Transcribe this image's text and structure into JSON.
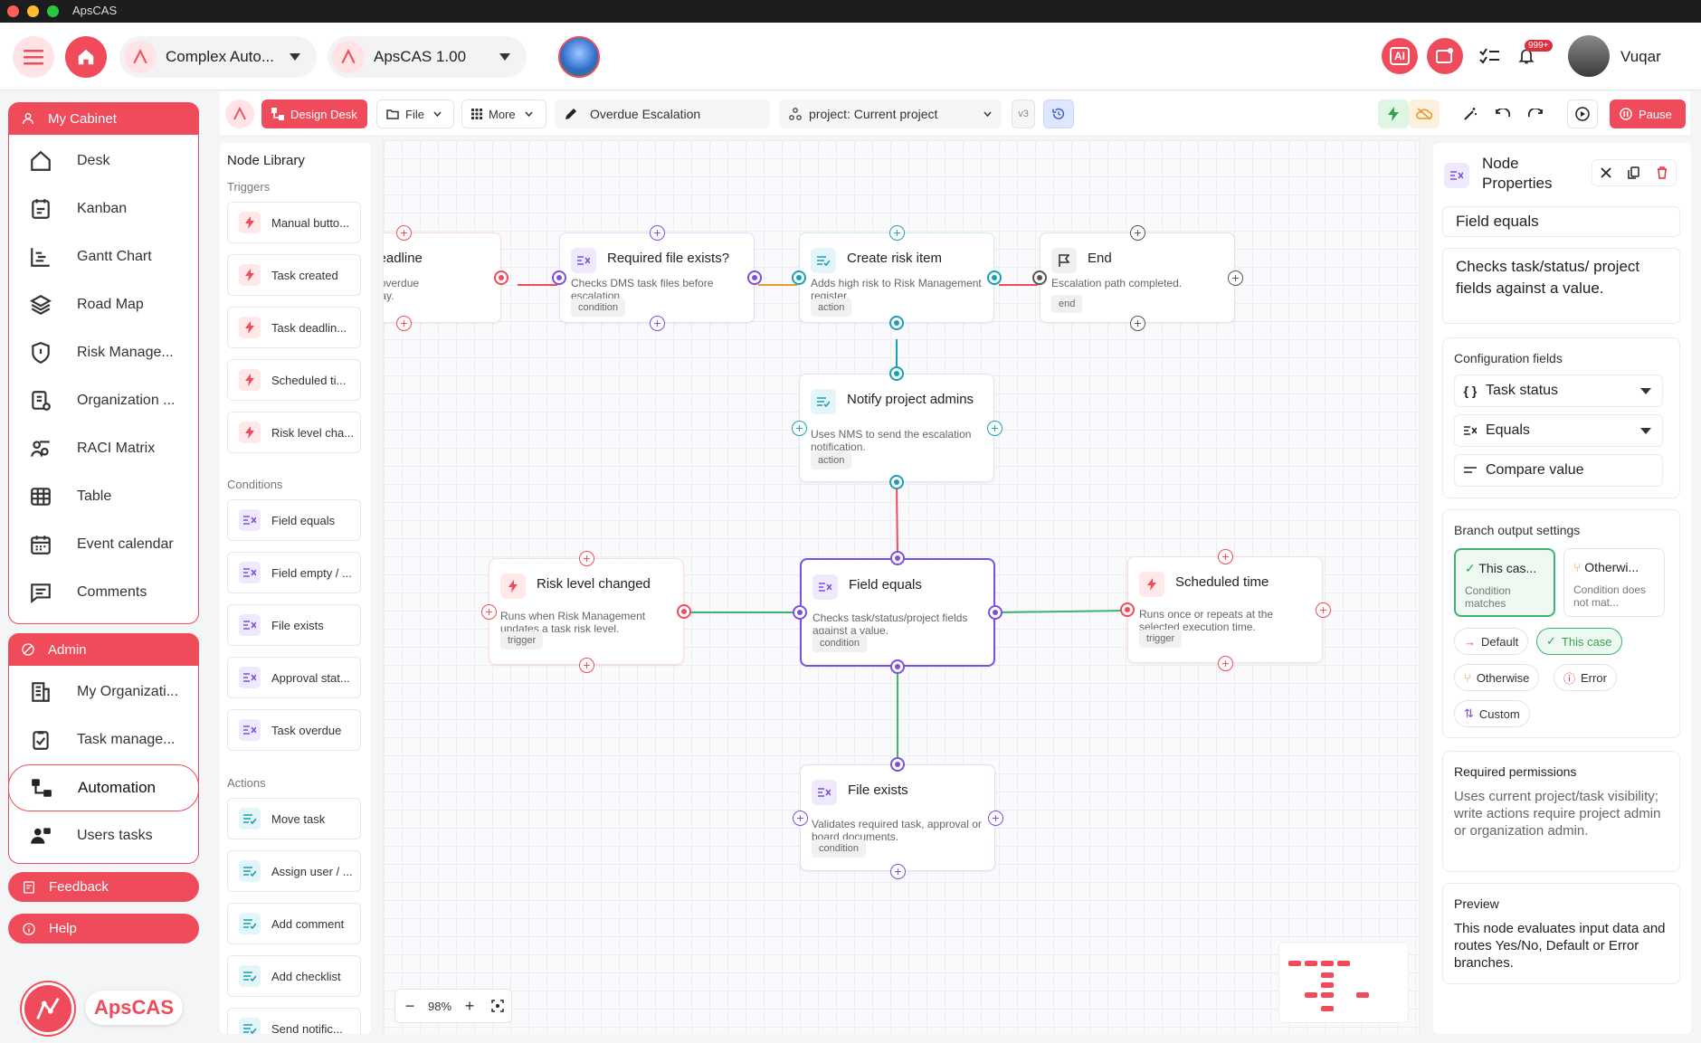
{
  "app": {
    "title": "ApsCAS",
    "user_name": "Vuqar",
    "notif_badge": "999+"
  },
  "header": {
    "project_selector": "Complex Auto...",
    "version_selector": "ApsCAS 1.00",
    "ai_label": "AI"
  },
  "sidebar": {
    "cabinet_title": "My Cabinet",
    "cabinet_items": [
      {
        "label": "Desk"
      },
      {
        "label": "Kanban"
      },
      {
        "label": "Gantt Chart"
      },
      {
        "label": "Road Map"
      },
      {
        "label": "Risk Manage..."
      },
      {
        "label": "Organization ..."
      },
      {
        "label": "RACI Matrix"
      },
      {
        "label": "Table"
      },
      {
        "label": "Event calendar"
      },
      {
        "label": "Comments"
      }
    ],
    "admin_title": "Admin",
    "admin_items": [
      {
        "label": "My Organizati..."
      },
      {
        "label": "Task manage..."
      },
      {
        "label": "Automation"
      },
      {
        "label": "Users tasks"
      }
    ],
    "feedback": "Feedback",
    "help": "Help",
    "logo_text": "ApsCAS"
  },
  "toolbar": {
    "design_desk": "Design Desk",
    "file": "File",
    "more": "More",
    "flow_name": "Overdue Escalation",
    "project": "project: Current project",
    "version": "v3",
    "pause": "Pause"
  },
  "library": {
    "title": "Node Library",
    "triggers_label": "Triggers",
    "triggers": [
      "Manual butto...",
      "Task created",
      "Task deadlin...",
      "Scheduled ti...",
      "Risk level cha..."
    ],
    "conditions_label": "Conditions",
    "conditions": [
      "Field equals",
      "Field empty / ...",
      "File exists",
      "Approval stat...",
      "Task overdue"
    ],
    "actions_label": "Actions",
    "actions": [
      "Move task",
      "Assign user / ...",
      "Add comment",
      "Add checklist",
      "Send notific..."
    ]
  },
  "canvas": {
    "zoom": "98%",
    "nodes": {
      "deadline": {
        "title": "sk deadline\nssed",
        "desc": "eduler emits overdue\nts once per day."
      },
      "required": {
        "title": "Required file exists?",
        "desc": "Checks DMS task files before escalation.",
        "tag": "condition"
      },
      "create": {
        "title": "Create risk item",
        "desc": "Adds high risk to Risk Management register.",
        "tag": "action"
      },
      "end": {
        "title": "End",
        "desc": "Escalation path completed.",
        "tag": "end"
      },
      "notify": {
        "title": "Notify project admins",
        "desc": "Uses NMS to send the escalation notification.",
        "tag": "action"
      },
      "risk": {
        "title": "Risk level changed",
        "desc": "Runs when Risk Management updates a task risk level.",
        "tag": "trigger"
      },
      "field": {
        "title": "Field equals",
        "desc": "Checks task/status/project fields against a value.",
        "tag": "condition"
      },
      "sched": {
        "title": "Scheduled time",
        "desc": "Runs once or repeats at the selected execution time.",
        "tag": "trigger"
      },
      "file": {
        "title": "File exists",
        "desc": "Validates required task, approval or board documents.",
        "tag": "condition"
      }
    }
  },
  "properties": {
    "title": "Node Properties",
    "node_name": "Field equals",
    "node_desc": "Checks task/status/ project fields against a value.",
    "config_label": "Configuration fields",
    "config_fields": [
      "Task status",
      "Equals",
      "Compare value"
    ],
    "branch_label": "Branch output settings",
    "branch_case": {
      "title": "This cas...",
      "sub": "Condition matches"
    },
    "branch_other": {
      "title": "Otherwi...",
      "sub": "Condition does not mat..."
    },
    "chips": [
      "Default",
      "This case",
      "Otherwise",
      "Error",
      "Custom"
    ],
    "perm_label": "Required permissions",
    "perm_text": "Uses current project/task visibility; write actions require project admin or organization admin.",
    "preview_label": "Preview",
    "preview_text": "This node evaluates input data and routes Yes/No, Default or Error branches."
  },
  "colors": {
    "brand": "#f04b5a",
    "condition": "#7b4fe0",
    "action": "#1aa0b4",
    "trigger": "#f04b5a",
    "edge_green": "#3cb371"
  }
}
